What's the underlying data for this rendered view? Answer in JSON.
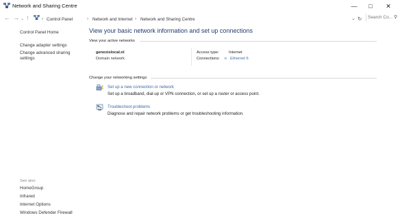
{
  "window": {
    "title": "Network and Sharing Centre"
  },
  "address": {
    "crumbs": [
      "Control Panel",
      "Network and Internet",
      "Network and Sharing Centre"
    ],
    "search_placeholder": "Search Co..."
  },
  "sidebar": {
    "home": "Control Panel Home",
    "links": [
      "Change adapter settings",
      "Change advanced sharing settings"
    ],
    "see_also_label": "See also",
    "see_also": [
      "HomeGroup",
      "Infrared",
      "Internet Options",
      "Windows Defender Firewall"
    ]
  },
  "main": {
    "title": "View your basic network information and set up connections",
    "active_networks_heading": "View your active networks",
    "network": {
      "name": "genexislocal.nl",
      "type": "Domain network",
      "access_type_label": "Access type:",
      "access_type_value": "Internet",
      "connections_label": "Connections:",
      "connections_value": "Ethernet 6"
    },
    "change_settings_heading": "Change your networking settings",
    "tasks": [
      {
        "link": "Set up a new connection or network",
        "desc": "Set up a broadband, dial-up or VPN connection, or set up a router or access point."
      },
      {
        "link": "Troubleshoot problems",
        "desc": "Diagnose and repair network problems or get troubleshooting information."
      }
    ]
  },
  "icons": {
    "app": "network-sharing-icon",
    "minimize": "minimize-icon",
    "maximize": "maximize-icon",
    "close": "close-icon",
    "back": "back-arrow-icon",
    "forward": "forward-arrow-icon",
    "recent": "chevron-down-icon",
    "up": "up-arrow-icon",
    "refresh": "refresh-icon",
    "search": "search-icon"
  }
}
